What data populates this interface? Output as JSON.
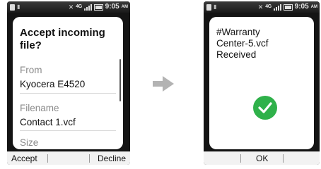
{
  "left_screen": {
    "status": {
      "time": "9:05",
      "ampm": "AM",
      "network": "4G"
    },
    "dialog": {
      "title": "Accept incoming file?",
      "from_label": "From",
      "from_value": "Kyocera E4520",
      "filename_label": "Filename",
      "filename_value": "Contact 1.vcf",
      "size_label": "Size"
    },
    "softkeys": {
      "left": "Accept",
      "right": "Decline"
    }
  },
  "right_screen": {
    "status": {
      "time": "9:05",
      "ampm": "AM",
      "network": "4G"
    },
    "message": {
      "line1": "#Warranty",
      "line2": "Center-5.vcf",
      "line3": "Received"
    },
    "softkeys": {
      "center": "OK"
    }
  },
  "colors": {
    "success": "#2fb14a",
    "arrow": "#b3b3b3",
    "phone_frame": "#141414"
  }
}
